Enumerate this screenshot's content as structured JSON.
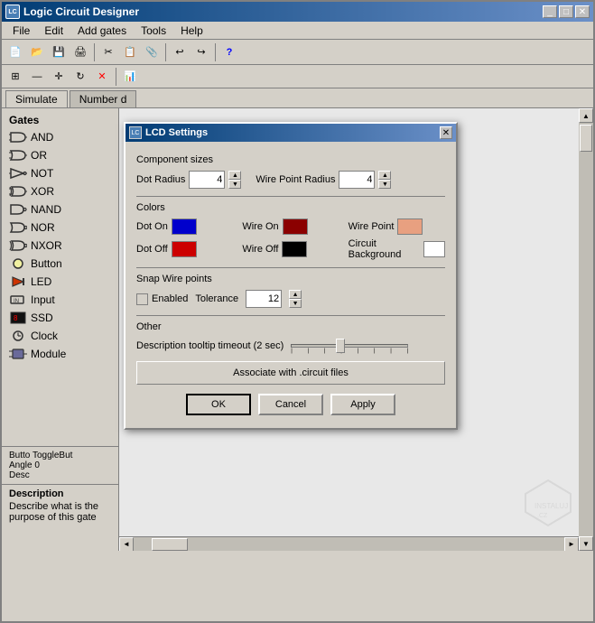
{
  "window": {
    "title": "Logic Circuit Designer",
    "icon": "LC"
  },
  "menu": {
    "items": [
      "File",
      "Edit",
      "Add gates",
      "Tools",
      "Help"
    ]
  },
  "tabs": {
    "items": [
      "Simulate",
      "Number d"
    ]
  },
  "gates": {
    "header": "Gates",
    "items": [
      {
        "label": "AND",
        "icon": "and"
      },
      {
        "label": "OR",
        "icon": "or"
      },
      {
        "label": "NOT",
        "icon": "not"
      },
      {
        "label": "XOR",
        "icon": "xor"
      },
      {
        "label": "NAND",
        "icon": "nand"
      },
      {
        "label": "NOR",
        "icon": "nor"
      },
      {
        "label": "NXOR",
        "icon": "nxor"
      },
      {
        "label": "Button",
        "icon": "button"
      },
      {
        "label": "LED",
        "icon": "led"
      },
      {
        "label": "Input",
        "icon": "input"
      },
      {
        "label": "SSD",
        "icon": "ssd"
      },
      {
        "label": "Clock",
        "icon": "clock"
      },
      {
        "label": "Module",
        "icon": "module"
      }
    ]
  },
  "properties": {
    "line1": "Butto ToggleBut",
    "line2": "Angle 0",
    "line3": "Desc"
  },
  "description": {
    "title": "Description",
    "text": "Describe what is the purpose of this gate"
  },
  "dialog": {
    "title": "LCD Settings",
    "icon": "LC",
    "sections": {
      "component_sizes": {
        "label": "Component sizes",
        "dot_radius_label": "Dot Radius",
        "dot_radius_value": "4",
        "wire_point_radius_label": "Wire Point Radius",
        "wire_point_radius_value": "4"
      },
      "colors": {
        "label": "Colors",
        "items": [
          {
            "label": "Dot On",
            "color": "#0000cc"
          },
          {
            "label": "Wire On",
            "color": "#8b0000"
          },
          {
            "label": "Wire Point",
            "color": "#e8a080"
          },
          {
            "label": "Dot Off",
            "color": "#cc0000"
          },
          {
            "label": "Wire Off",
            "color": "#000000"
          },
          {
            "label": "Circuit Background",
            "color": "#ffffff"
          }
        ]
      },
      "snap_wire": {
        "label": "Snap Wire points",
        "enabled_label": "Enabled",
        "enabled": false,
        "tolerance_label": "Tolerance",
        "tolerance_value": "12"
      },
      "other": {
        "label": "Other",
        "timeout_label": "Description tooltip timeout (2 sec)",
        "slider_value": 40
      }
    },
    "associate_btn_label": "Associate with .circuit files",
    "buttons": {
      "ok": "OK",
      "cancel": "Cancel",
      "apply": "Apply"
    }
  }
}
